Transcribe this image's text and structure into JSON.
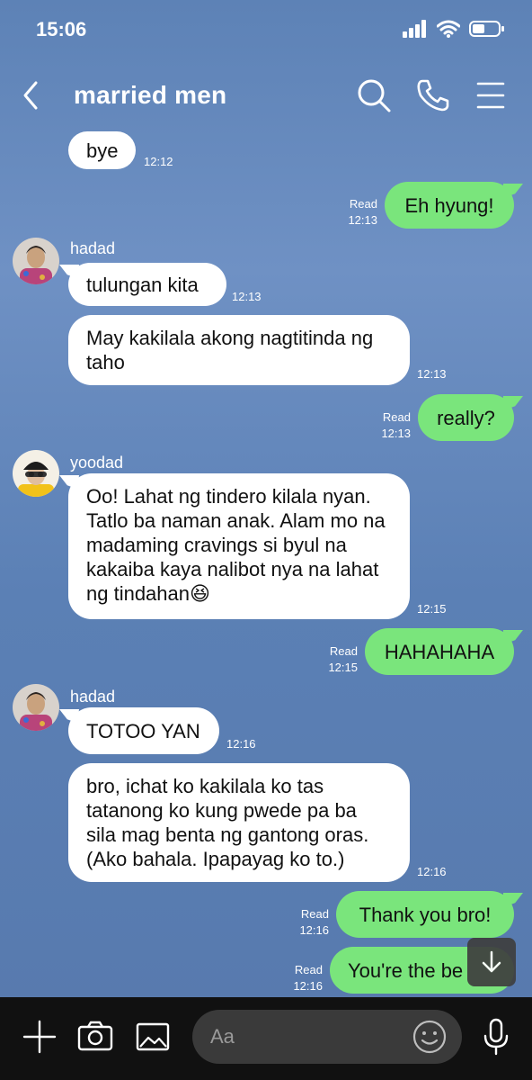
{
  "status": {
    "time": "15:06"
  },
  "header": {
    "title": "married men"
  },
  "messages": [
    {
      "side": "in",
      "text": "bye",
      "time": "12:12"
    },
    {
      "side": "out",
      "text": "Eh hyung!",
      "read": "Read",
      "time": "12:13"
    },
    {
      "side": "in",
      "sender": "hadad",
      "text": "tulungan kita",
      "time": "12:13"
    },
    {
      "side": "in",
      "text": "May kakilala akong nagtitinda ng taho",
      "time": "12:13"
    },
    {
      "side": "out",
      "text": "really?",
      "read": "Read",
      "time": "12:13"
    },
    {
      "side": "in",
      "sender": "yoodad",
      "text": "Oo! Lahat ng tindero kilala nyan. Tatlo ba naman anak. Alam mo na madaming cravings si byul na kakaiba kaya nalibot nya na lahat ng tindahan😆",
      "time": "12:15"
    },
    {
      "side": "out",
      "text": "HAHAHAHA",
      "read": "Read",
      "time": "12:15"
    },
    {
      "side": "in",
      "sender": "hadad",
      "text": "TOTOO YAN",
      "time": "12:16"
    },
    {
      "side": "in",
      "text": "bro, ichat ko kakilala ko tas tatanong ko kung pwede pa ba sila mag benta ng gantong oras. (Ako bahala. Ipapayag ko to.)",
      "time": "12:16"
    },
    {
      "side": "out",
      "text": "Thank you bro!",
      "read": "Read",
      "time": "12:16"
    },
    {
      "side": "out",
      "text": "You're the be",
      "read": "Read",
      "time": "12:16"
    }
  ],
  "composer": {
    "placeholder": "Aa"
  },
  "colors": {
    "background": "#5d82b6",
    "outgoing_bubble": "#7ae57c",
    "incoming_bubble": "#ffffff",
    "bottom_bar": "#111111"
  },
  "icons": [
    "back-icon",
    "search-icon",
    "phone-icon",
    "menu-icon",
    "plus-icon",
    "camera-icon",
    "image-icon",
    "emoji-icon",
    "microphone-icon",
    "arrow-down-icon",
    "signal-icon",
    "wifi-icon",
    "battery-icon"
  ]
}
